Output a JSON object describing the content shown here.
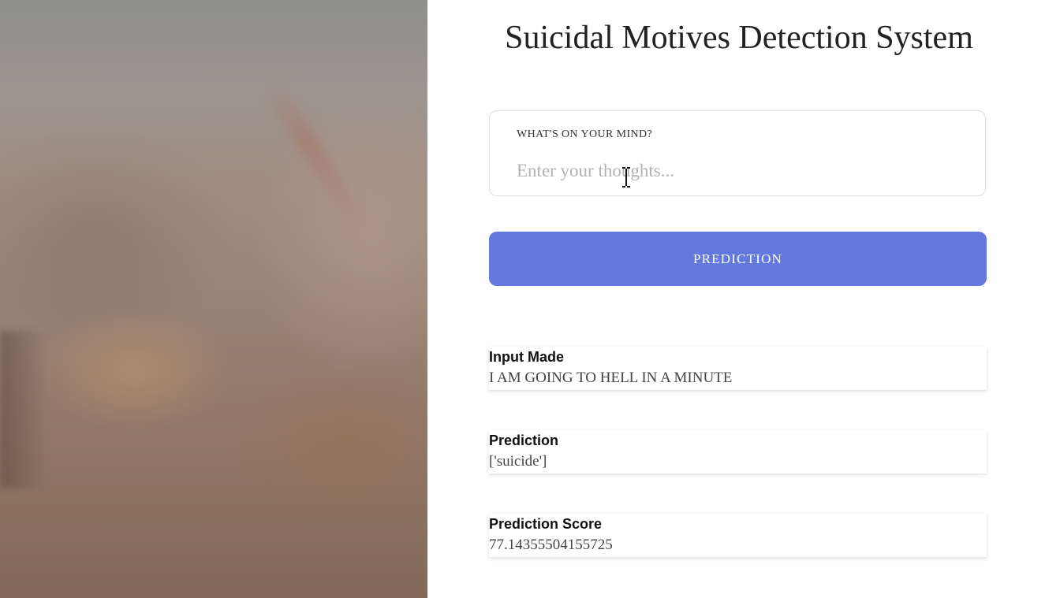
{
  "header": {
    "title": "Suicidal Motives Detection System"
  },
  "form": {
    "label": "WHAT'S ON YOUR MIND?",
    "placeholder": "Enter your thoughts...",
    "value": "",
    "button_label": "PREDICTION"
  },
  "results": {
    "input_made": {
      "heading": "Input Made",
      "value": "I AM GOING TO HELL IN A MINUTE"
    },
    "prediction": {
      "heading": "Prediction",
      "value": "['suicide']"
    },
    "prediction_score": {
      "heading": "Prediction Score",
      "value": "77.14355504155725"
    }
  },
  "icons": {
    "cursor": "text-cursor-icon"
  },
  "colors": {
    "button": "#6479e0",
    "button_text": "#ffffff",
    "title": "#222222"
  }
}
